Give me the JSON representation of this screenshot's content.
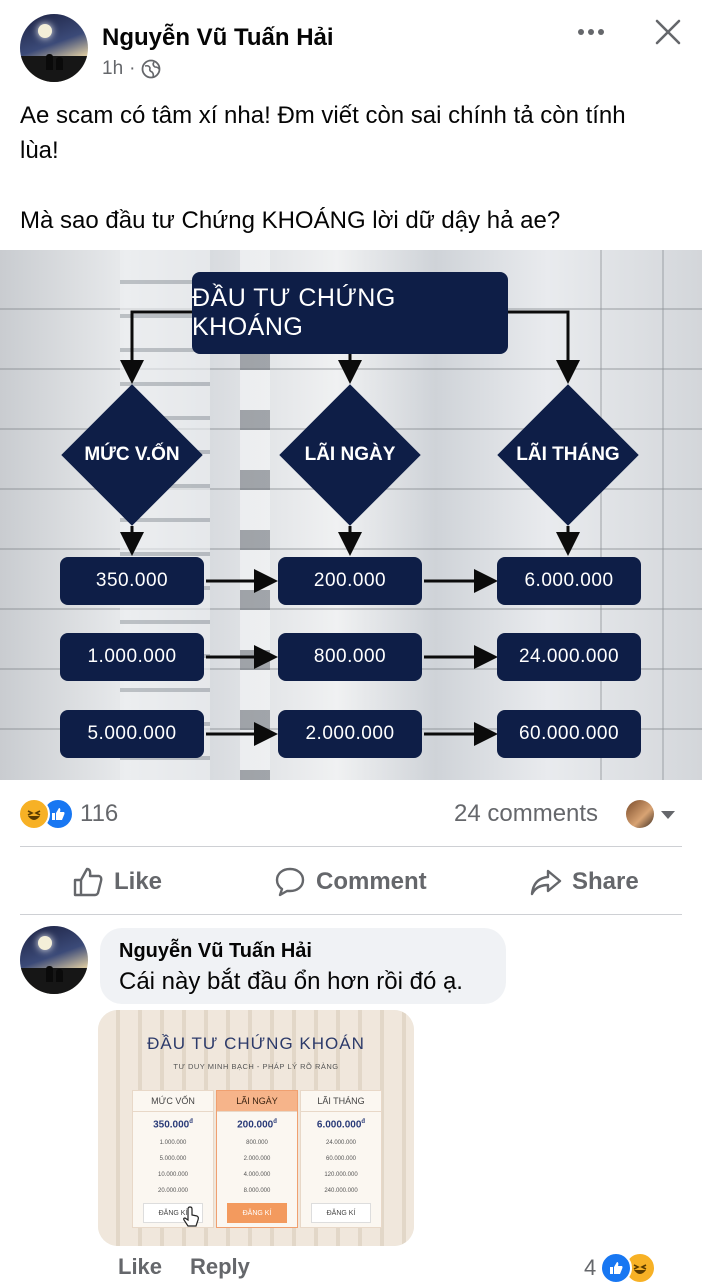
{
  "post": {
    "author": "Nguyễn Vũ Tuấn Hải",
    "time": "1h",
    "dot": "·",
    "text_line1": "Ae scam có tâm xí nha! Đm viết còn sai chính tả còn tính",
    "text_line2": "lùa!",
    "text_line3": "Mà sao đầu tư Chứng KHOÁNG lời dữ dậy hả ae?"
  },
  "flowchart": {
    "title": "ĐẦU TƯ CHỨNG KHOÁNG",
    "headers": [
      "MỨC V.ỐN",
      "LÃI NGÀY",
      "LÃI THÁNG"
    ],
    "rows": [
      [
        "350.000",
        "200.000",
        "6.000.000"
      ],
      [
        "1.000.000",
        "800.000",
        "24.000.000"
      ],
      [
        "5.000.000",
        "2.000.000",
        "60.000.000"
      ]
    ],
    "node_color": "#0e1e47"
  },
  "stats": {
    "reaction_count": "116",
    "comments": "24 comments",
    "reaction_icons": [
      "haha-icon",
      "like-icon"
    ]
  },
  "actions": {
    "like": "Like",
    "comment": "Comment",
    "share": "Share"
  },
  "comment": {
    "author": "Nguyễn Vũ Tuấn Hải",
    "text": "Cái này bắt đầu ổn hơn rồi đó ạ.",
    "like": "Like",
    "reply": "Reply",
    "reaction_count": "4",
    "image": {
      "title": "ĐẦU TƯ CHỨNG KHOÁN",
      "subtitle": "TƯ DUY MINH BẠCH - PHÁP LÝ RÕ RÀNG",
      "columns": [
        {
          "header": "MỨC VỐN",
          "top": "350.000",
          "values": [
            "1.000.000",
            "5.000.000",
            "10.000.000",
            "20.000.000"
          ],
          "button": "ĐĂNG KÍ"
        },
        {
          "header": "LÃI NGÀY",
          "top": "200.000",
          "values": [
            "800.000",
            "2.000.000",
            "4.000.000",
            "8.000.000"
          ],
          "button": "ĐĂNG KÍ"
        },
        {
          "header": "LÃI THÁNG",
          "top": "6.000.000",
          "values": [
            "24.000.000",
            "60.000.000",
            "120.000.000",
            "240.000.000"
          ],
          "button": "ĐĂNG KÍ"
        }
      ],
      "superscript": "đ"
    }
  },
  "colors": {
    "accent_blue": "#1877f2",
    "haha_yellow": "#f7b125",
    "meta_gray": "#65676b"
  }
}
